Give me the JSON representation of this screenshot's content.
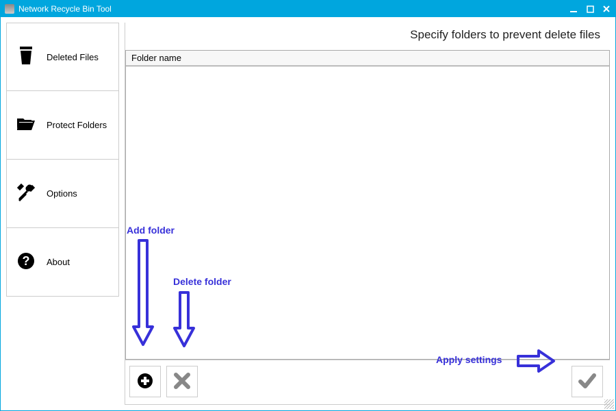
{
  "window": {
    "title": "Network Recycle Bin Tool"
  },
  "sidebar": {
    "items": [
      {
        "label": "Deleted Files"
      },
      {
        "label": "Protect Folders"
      },
      {
        "label": "Options"
      },
      {
        "label": "About"
      }
    ]
  },
  "main": {
    "header": "Specify folders to prevent delete files",
    "column_header": "Folder name"
  },
  "annotations": {
    "add_folder": "Add folder",
    "delete_folder": "Delete folder",
    "apply_settings": "Apply settings"
  },
  "colors": {
    "accent": "#00a6de",
    "annotation": "#3730d9"
  }
}
